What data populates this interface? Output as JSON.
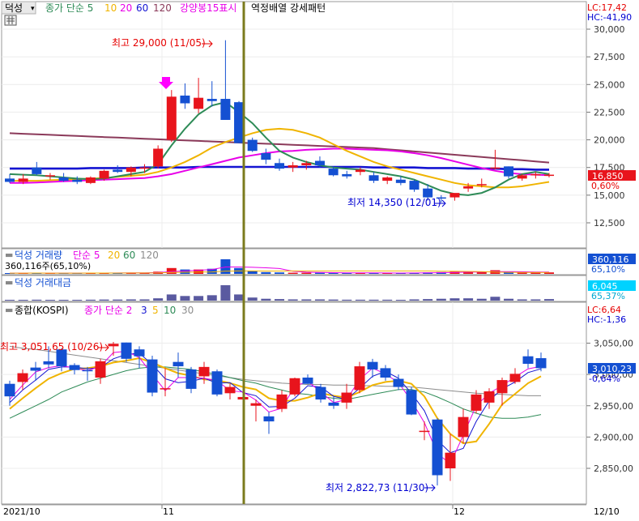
{
  "colors": {
    "up": "#e8141c",
    "down": "#1450d2",
    "ma5": "#2e8b57",
    "ma10": "#f0b400",
    "ma20": "#e800e8",
    "ma60": "#1414d2",
    "ma120": "#8b3a5a",
    "divider": "#7b7b1e",
    "text_red": "#e60000",
    "text_blue": "#0000d2"
  },
  "top_panel": {
    "title": "덕성",
    "ma_legend": [
      {
        "label": "종가 단순 5",
        "color": "#2e8b57"
      },
      {
        "label": "10",
        "color": "#f0b400"
      },
      {
        "label": "20",
        "color": "#e800e8"
      },
      {
        "label": "60",
        "color": "#1414d2"
      },
      {
        "label": "120",
        "color": "#8b3a5a"
      }
    ],
    "indicator_labels": [
      "강양봉15표시",
      "역정배열 강세패턴"
    ],
    "lc": "LC:17,42",
    "hc": "HC:-41,90",
    "price_ticks": [
      "30,000",
      "27,500",
      "25,000",
      "22,500",
      "20,000",
      "17,500",
      "15,000",
      "12,500"
    ],
    "current_price": "16,850",
    "current_change": "0,60%",
    "high_annotation": "최고 29,000 (11/05)",
    "low_annotation": "최저 14,350 (12/01)"
  },
  "volume_panel": {
    "title": "덕성 거래량",
    "ma_legend": [
      {
        "label": "단순 5",
        "color": "#e800e8"
      },
      {
        "label": "20",
        "color": "#f0b400"
      },
      {
        "label": "60",
        "color": "#2e8b57"
      },
      {
        "label": "120",
        "color": "#8c8c8c"
      }
    ],
    "volume_text": "360,116주(65,10%)",
    "badge_value": "360,116",
    "badge_pct": "65,10%"
  },
  "amount_panel": {
    "title": "덕성 거래대금",
    "badge_value": "6,045",
    "badge_pct": "65,37%"
  },
  "kospi_panel": {
    "title": "종합(KOSPI)",
    "ma_legend": [
      {
        "label": "종가 단순 2",
        "color": "#e800e8"
      },
      {
        "label": "3",
        "color": "#1414d2"
      },
      {
        "label": "5",
        "color": "#f0b400"
      },
      {
        "label": "10",
        "color": "#2e8b57"
      },
      {
        "label": "30",
        "color": "#8c8c8c"
      }
    ],
    "lc": "LC:6,64",
    "hc": "HC:-1,36",
    "price_ticks": [
      "3,050,00",
      "3,000,00",
      "2,950,00",
      "2,900,00",
      "2,850,00"
    ],
    "current_price": "3,010,23",
    "current_change": "-0,64%",
    "high_annotation": "최고 3,051,65 (10/26)",
    "low_annotation": "최저 2,822,73 (11/30)"
  },
  "x_axis": {
    "labels": [
      "2021/10",
      "11",
      "12",
      "12/10"
    ]
  },
  "chart_data": {
    "type": "candlestick",
    "title": "덕성",
    "stock": {
      "dates": [
        "10/15",
        "10/18",
        "10/19",
        "10/20",
        "10/21",
        "10/22",
        "10/25",
        "10/26",
        "10/27",
        "10/28",
        "10/29",
        "11/01",
        "11/02",
        "11/03",
        "11/04",
        "11/05",
        "11/08",
        "11/09",
        "11/10",
        "11/11",
        "11/12",
        "11/15",
        "11/16",
        "11/17",
        "11/18",
        "11/19",
        "11/22",
        "11/23",
        "11/24",
        "11/25",
        "11/26",
        "11/29",
        "11/30",
        "12/01",
        "12/02",
        "12/03",
        "12/06",
        "12/07",
        "12/08",
        "12/09",
        "12/10"
      ],
      "ohlc": [
        [
          16500,
          16900,
          16100,
          16200
        ],
        [
          16200,
          16900,
          16000,
          16500
        ],
        [
          17500,
          18000,
          16800,
          16900
        ],
        [
          16700,
          17000,
          16400,
          16800
        ],
        [
          16600,
          17000,
          16200,
          16300
        ],
        [
          16400,
          16700,
          16000,
          16200
        ],
        [
          16100,
          16700,
          16000,
          16600
        ],
        [
          16500,
          17300,
          16300,
          17200
        ],
        [
          17300,
          17700,
          17000,
          17100
        ],
        [
          17100,
          17600,
          16700,
          17500
        ],
        [
          17400,
          17800,
          17000,
          17500
        ],
        [
          17600,
          19500,
          17400,
          19200
        ],
        [
          20000,
          24500,
          19800,
          23900
        ],
        [
          24000,
          25100,
          22800,
          23300
        ],
        [
          22800,
          25600,
          22400,
          23800
        ],
        [
          23700,
          25300,
          23000,
          23500
        ],
        [
          23700,
          29000,
          22300,
          21800
        ],
        [
          23400,
          23500,
          19700,
          19700
        ],
        [
          20000,
          20200,
          18900,
          19000
        ],
        [
          18800,
          19200,
          17800,
          18200
        ],
        [
          17900,
          18300,
          17200,
          17400
        ],
        [
          17500,
          18000,
          17100,
          17700
        ],
        [
          17700,
          18100,
          17300,
          17900
        ],
        [
          18100,
          18500,
          17500,
          17700
        ],
        [
          17400,
          17600,
          16700,
          16800
        ],
        [
          16900,
          17200,
          16500,
          16700
        ],
        [
          17100,
          17500,
          16800,
          17300
        ],
        [
          16800,
          17100,
          16100,
          16300
        ],
        [
          16300,
          16700,
          16000,
          16600
        ],
        [
          16400,
          16700,
          15900,
          16100
        ],
        [
          16300,
          16400,
          15300,
          15500
        ],
        [
          15600,
          16000,
          14500,
          14800
        ],
        [
          14800,
          15000,
          14350,
          14700
        ],
        [
          14800,
          15100,
          14500,
          15200
        ],
        [
          15600,
          16100,
          15300,
          15800
        ],
        [
          16000,
          16500,
          15700,
          16000
        ],
        [
          17400,
          19100,
          17300,
          17500
        ],
        [
          17600,
          17600,
          16500,
          16700
        ],
        [
          16500,
          16900,
          16300,
          16800
        ],
        [
          16800,
          17100,
          16500,
          16900
        ],
        [
          16800,
          17000,
          16600,
          16850
        ]
      ],
      "ma5": [
        16900,
        16850,
        16800,
        16700,
        16600,
        16500,
        16450,
        16500,
        16700,
        16900,
        17100,
        17800,
        19500,
        21000,
        22300,
        23100,
        23400,
        22500,
        21500,
        20200,
        19000,
        18400,
        18000,
        17700,
        17500,
        17400,
        17300,
        17100,
        16900,
        16700,
        16400,
        15900,
        15400,
        15100,
        15000,
        15200,
        15700,
        16400,
        16900,
        17100,
        16900
      ],
      "ma10": [
        16300,
        16300,
        16300,
        16350,
        16400,
        16450,
        16500,
        16550,
        16650,
        16750,
        16850,
        17100,
        17500,
        18000,
        18600,
        19300,
        19800,
        20200,
        20600,
        20900,
        21000,
        20900,
        20600,
        20200,
        19600,
        19000,
        18500,
        18000,
        17600,
        17300,
        17000,
        16700,
        16400,
        16100,
        15900,
        15800,
        15700,
        15700,
        15800,
        16000,
        16200
      ],
      "ma20": [
        16100,
        16100,
        16150,
        16200,
        16250,
        16300,
        16350,
        16400,
        16450,
        16500,
        16550,
        16700,
        16900,
        17200,
        17500,
        17800,
        18100,
        18400,
        18600,
        18800,
        18950,
        19000,
        19100,
        19150,
        19200,
        19200,
        19150,
        19100,
        19050,
        18950,
        18800,
        18600,
        18350,
        18050,
        17750,
        17450,
        17200,
        17000,
        16900,
        16850,
        16800
      ],
      "ma60": [
        17400,
        17400,
        17400,
        17400,
        17400,
        17400,
        17450,
        17450,
        17450,
        17450,
        17500,
        17500,
        17500,
        17500,
        17550,
        17550,
        17550,
        17550,
        17550,
        17550,
        17550,
        17550,
        17550,
        17550,
        17550,
        17550,
        17550,
        17500,
        17500,
        17500,
        17500,
        17450,
        17450,
        17450,
        17400,
        17400,
        17400,
        17350,
        17350,
        17300,
        17300
      ],
      "ma120": [
        20600,
        20550,
        20500,
        20450,
        20400,
        20350,
        20300,
        20250,
        20200,
        20150,
        20100,
        20050,
        20000,
        19950,
        19900,
        19850,
        19800,
        19750,
        19700,
        19650,
        19600,
        19550,
        19500,
        19450,
        19400,
        19350,
        19300,
        19250,
        19150,
        19050,
        18950,
        18850,
        18750,
        18650,
        18550,
        18450,
        18350,
        18250,
        18150,
        18050,
        17950
      ]
    },
    "volume_rel": [
      0.05,
      0.05,
      0.06,
      0.05,
      0.05,
      0.05,
      0.06,
      0.07,
      0.07,
      0.08,
      0.08,
      0.15,
      0.4,
      0.3,
      0.3,
      0.35,
      1.0,
      0.4,
      0.2,
      0.12,
      0.1,
      0.08,
      0.08,
      0.08,
      0.07,
      0.06,
      0.06,
      0.06,
      0.06,
      0.05,
      0.08,
      0.1,
      0.12,
      0.15,
      0.15,
      0.12,
      0.25,
      0.12,
      0.08,
      0.08,
      0.1
    ],
    "kospi": {
      "dates": [
        "10/14",
        "10/15",
        "10/18",
        "10/19",
        "10/20",
        "10/21",
        "10/22",
        "10/25",
        "10/26",
        "10/27",
        "10/28",
        "10/29",
        "11/01",
        "11/02",
        "11/03",
        "11/04",
        "11/05",
        "11/08",
        "11/09",
        "11/10",
        "11/11",
        "11/12",
        "11/15",
        "11/16",
        "11/17",
        "11/18",
        "11/19",
        "11/22",
        "11/23",
        "11/24",
        "11/25",
        "11/26",
        "11/29",
        "11/30",
        "12/01",
        "12/02",
        "12/03",
        "12/06",
        "12/07",
        "12/08",
        "12/09",
        "12/10"
      ],
      "ohlc": [
        [
          2985,
          2990,
          2950,
          2965
        ],
        [
          2988,
          3008,
          2975,
          3002
        ],
        [
          3011,
          3020,
          2990,
          3006
        ],
        [
          3021,
          3045,
          3010,
          3016
        ],
        [
          3040,
          3042,
          3005,
          3013
        ],
        [
          3015,
          3018,
          3000,
          3007
        ],
        [
          3007,
          3012,
          2990,
          3006
        ],
        [
          2995,
          3025,
          2985,
          3021
        ],
        [
          3045,
          3052,
          3030,
          3049
        ],
        [
          3051,
          3051,
          3020,
          3025
        ],
        [
          3040,
          3045,
          3010,
          3029
        ],
        [
          3024,
          3030,
          2965,
          2971
        ],
        [
          2978,
          3010,
          2965,
          2978
        ],
        [
          3020,
          3035,
          2995,
          3013
        ],
        [
          3008,
          3012,
          2970,
          2977
        ],
        [
          2997,
          3020,
          2985,
          3012
        ],
        [
          3005,
          3008,
          2965,
          2968
        ],
        [
          2970,
          2985,
          2960,
          2980
        ],
        [
          2960,
          2965,
          2945,
          2964
        ],
        [
          2950,
          2960,
          2925,
          2954
        ],
        [
          2933,
          2940,
          2905,
          2925
        ],
        [
          2945,
          2975,
          2940,
          2968
        ],
        [
          2968,
          2995,
          2965,
          2994
        ],
        [
          2995,
          3000,
          2985,
          2985
        ],
        [
          2980,
          2985,
          2955,
          2960
        ],
        [
          2955,
          2965,
          2945,
          2950
        ],
        [
          2955,
          2985,
          2945,
          2971
        ],
        [
          2975,
          3020,
          2970,
          3013
        ],
        [
          3020,
          3025,
          2995,
          3008
        ],
        [
          3010,
          3015,
          2990,
          2995
        ],
        [
          2993,
          3000,
          2975,
          2980
        ],
        [
          2975,
          2980,
          2935,
          2936
        ],
        [
          2910,
          2925,
          2895,
          2910
        ],
        [
          2928,
          2930,
          2822.73,
          2839
        ],
        [
          2850,
          2905,
          2830,
          2875
        ],
        [
          2900,
          2945,
          2890,
          2932
        ],
        [
          2942,
          2975,
          2938,
          2968
        ],
        [
          2955,
          2978,
          2945,
          2973
        ],
        [
          2970,
          2995,
          2950,
          2991
        ],
        [
          2988,
          3010,
          2985,
          3001
        ],
        [
          3029,
          3040,
          3010,
          3017
        ],
        [
          3026,
          3035,
          3005,
          3010
        ]
      ],
      "ma2": [
        2960,
        2983,
        3004,
        3011,
        3014,
        3010,
        3006,
        3013,
        3035,
        3037,
        3027,
        3000,
        2974,
        2995,
        2995,
        2994,
        2990,
        2974,
        2972,
        2959,
        2940,
        2946,
        2981,
        2989,
        2972,
        2955,
        2960,
        2992,
        3010,
        3001,
        2987,
        2958,
        2923,
        2874,
        2857,
        2903,
        2950,
        2970,
        2982,
        2996,
        3009,
        3013
      ],
      "ma3": [
        2955,
        2975,
        2991,
        3008,
        3012,
        3012,
        3009,
        3011,
        3025,
        3032,
        3034,
        3016,
        2993,
        2987,
        2989,
        2994,
        2986,
        2987,
        2971,
        2966,
        2948,
        2949,
        2962,
        2982,
        2980,
        2965,
        2960,
        2978,
        2997,
        3005,
        2994,
        2970,
        2942,
        2895,
        2875,
        2882,
        2925,
        2958,
        2977,
        2988,
        3003,
        3009
      ],
      "ma5": [
        2945,
        2962,
        2978,
        2993,
        3002,
        3009,
        3010,
        3013,
        3019,
        3022,
        3026,
        3019,
        3010,
        3002,
        2998,
        2992,
        2991,
        2986,
        2980,
        2976,
        2962,
        2958,
        2958,
        2963,
        2970,
        2966,
        2963,
        2972,
        2983,
        2988,
        2990,
        2985,
        2965,
        2930,
        2905,
        2890,
        2893,
        2921,
        2952,
        2969,
        2986,
        2997
      ],
      "ma10": [
        2930,
        2940,
        2950,
        2960,
        2972,
        2980,
        2988,
        2994,
        3000,
        3006,
        3010,
        3012,
        3012,
        3010,
        3008,
        3004,
        3000,
        2995,
        2990,
        2986,
        2980,
        2975,
        2970,
        2968,
        2965,
        2962,
        2960,
        2964,
        2968,
        2972,
        2976,
        2976,
        2972,
        2964,
        2955,
        2945,
        2938,
        2932,
        2930,
        2930,
        2932,
        2936
      ],
      "ma30": [
        3045,
        3042,
        3040,
        3037,
        3034,
        3031,
        3028,
        3025,
        3022,
        3019,
        3016,
        3013,
        3010,
        3007,
        3004,
        3001,
        2998,
        2995,
        2992,
        2990,
        2988,
        2986,
        2985,
        2984,
        2984,
        2983,
        2983,
        2982,
        2982,
        2981,
        2981,
        2980,
        2978,
        2976,
        2974,
        2972,
        2970,
        2969,
        2968,
        2967,
        2966,
        2966
      ]
    }
  }
}
